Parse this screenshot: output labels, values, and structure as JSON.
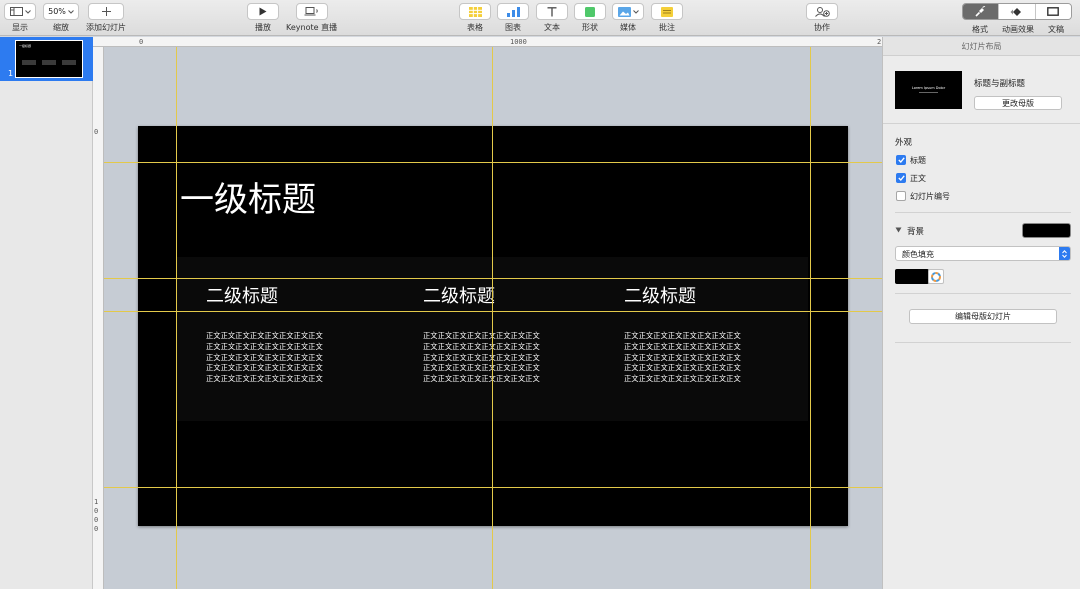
{
  "toolbar": {
    "view": {
      "label": "显示"
    },
    "zoom": {
      "value": "50%",
      "label": "缩放"
    },
    "add_slide": {
      "label": "添加幻灯片"
    },
    "play": {
      "label": "播放"
    },
    "keynote_live": {
      "label": "Keynote 直播"
    },
    "table": {
      "label": "表格"
    },
    "chart": {
      "label": "图表"
    },
    "text": {
      "label": "文本"
    },
    "shape": {
      "label": "形状"
    },
    "media": {
      "label": "媒体"
    },
    "comment": {
      "label": "批注"
    },
    "collaborate": {
      "label": "协作"
    },
    "format": {
      "label": "格式"
    },
    "animate": {
      "label": "动画效果"
    },
    "document": {
      "label": "文稿"
    }
  },
  "navigator": {
    "slides": [
      {
        "number": "1",
        "thumb_title": "一级标题"
      }
    ]
  },
  "rulers": {
    "top": [
      "0",
      "1000",
      "2"
    ],
    "left": [
      "0",
      "1",
      "0",
      "0",
      "0"
    ]
  },
  "slide": {
    "title": "一级标题",
    "columns": [
      {
        "heading": "二级标题",
        "body_lines": [
          "正文正文正文正文正文正文正文正文",
          "正文正文正文正文正文正文正文正文",
          "正文正文正文正文正文正文正文正文",
          "正文正文正文正文正文正文正文正文",
          "正文正文正文正文正文正文正文正文"
        ]
      },
      {
        "heading": "二级标题",
        "body_lines": [
          "正文正文正文正文正文正文正文正文",
          "正文正文正文正文正文正文正文正文",
          "正文正文正文正文正文正文正文正文",
          "正文正文正文正文正文正文正文正文",
          "正文正文正文正文正文正文正文正文"
        ]
      },
      {
        "heading": "二级标题",
        "body_lines": [
          "正文正文正文正文正文正文正文正文",
          "正文正文正文正文正文正文正文正文",
          "正文正文正文正文正文正文正文正文",
          "正文正文正文正文正文正文正文正文",
          "正文正文正文正文正文正文正文正文"
        ]
      }
    ]
  },
  "inspector": {
    "header": "幻灯片布局",
    "master": {
      "thumb_text": "Lorem Ipsum Dolor",
      "name": "标题与副标题",
      "change_button": "更改母版"
    },
    "appearance": {
      "heading": "外观",
      "options": [
        {
          "label": "标题",
          "checked": true
        },
        {
          "label": "正文",
          "checked": true
        },
        {
          "label": "幻灯片编号",
          "checked": false
        }
      ]
    },
    "background": {
      "heading": "背景",
      "fill_type": "颜色填充",
      "color": "#000000"
    },
    "edit_master_button": "编辑母版幻灯片"
  },
  "colors": {
    "accent": "#2d7bf0",
    "guide": "#e3c94a",
    "slide_bg": "#000000"
  }
}
